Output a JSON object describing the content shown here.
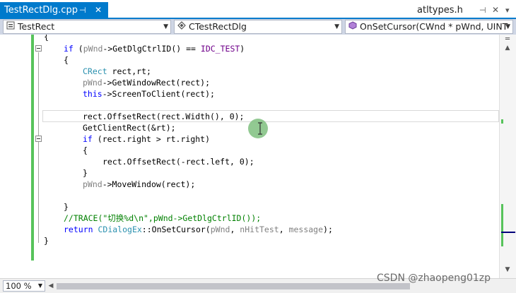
{
  "tabs": {
    "active": {
      "label": "TestRectDlg.cpp",
      "pin": "⊣",
      "close": "✕"
    },
    "other": {
      "label": "atltypes.h",
      "pin": "⊣",
      "close": "✕",
      "dropdown": "▾"
    }
  },
  "navbar": {
    "project": "TestRect",
    "class": "CTestRectDlg",
    "member": "OnSetCursor(CWnd * pWnd, UINT"
  },
  "code": {
    "l1": "{",
    "l2": "if",
    "l2b": " (",
    "l2c": "pWnd",
    "l2d": "->GetDlgCtrlID() == ",
    "l2e": "IDC_TEST",
    "l2f": ")",
    "l3": "{",
    "l4a": "CRect",
    "l4b": " rect,rt;",
    "l5a": "pWnd",
    "l5b": "->GetWindowRect(rect);",
    "l6a": "this",
    "l6b": "->ScreenToClient(rect);",
    "l7": "rect.OffsetRect(rect.Width(), 0);",
    "l8": "GetClientRect(&rt);",
    "l9a": "if",
    "l9b": " (rect.right > rt.right)",
    "l10": "{",
    "l11": "rect.OffsetRect(-rect.left, 0);",
    "l12": "}",
    "l13a": "pWnd",
    "l13b": "->MoveWindow(rect);",
    "l14": "}",
    "l15": "//TRACE(\"切换%d\\n\",pWnd->GetDlgCtrlID());",
    "l16a": "return",
    "l16b": " ",
    "l16c": "CDialogEx",
    "l16d": "::OnSetCursor(",
    "l16e": "pWnd",
    "l16f": ", ",
    "l16g": "nHitTest",
    "l16h": ", ",
    "l16i": "message",
    "l16j": ");",
    "l17": "}"
  },
  "zoom": "100 %",
  "watermark": "CSDN @zhaopeng01zp",
  "colors": {
    "accent": "#007acc",
    "change_bar": "#57c35b",
    "keyword": "#0000ff",
    "type": "#2b91af",
    "parameter": "#808080",
    "macro": "#6f008a",
    "comment": "#008000"
  }
}
